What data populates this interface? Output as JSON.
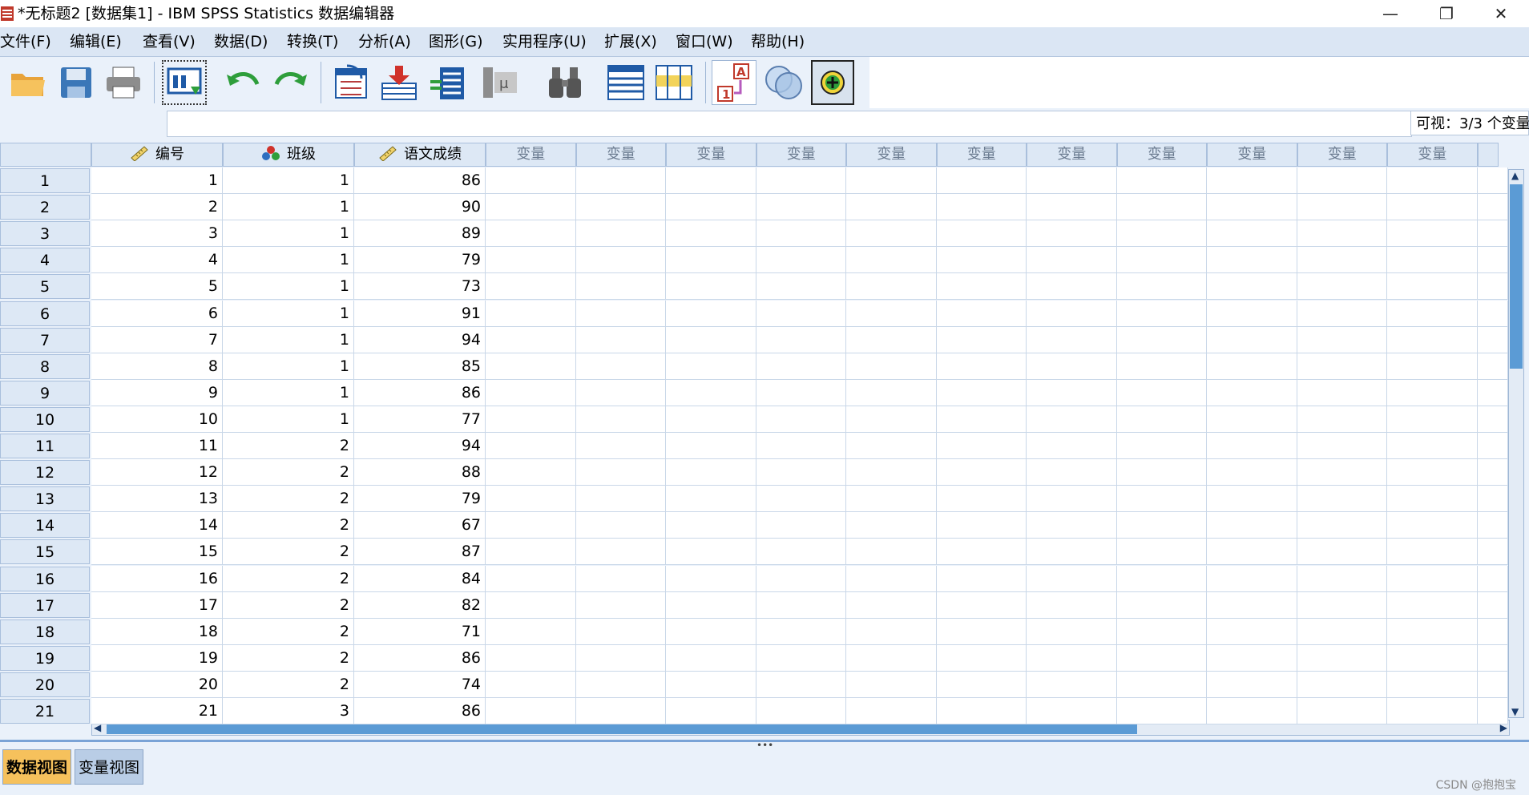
{
  "window": {
    "title": "*无标题2 [数据集1] - IBM SPSS Statistics 数据编辑器",
    "minimize": "—",
    "restore": "❐",
    "close": "✕"
  },
  "menu": [
    "文件(F)",
    "编辑(E)",
    "查看(V)",
    "数据(D)",
    "转换(T)",
    "分析(A)",
    "图形(G)",
    "实用程序(U)",
    "扩展(X)",
    "窗口(W)",
    "帮助(H)"
  ],
  "toolbar_icons": [
    "open-folder-icon",
    "save-icon",
    "print-icon",
    "recall-dialog-icon",
    "undo-icon",
    "redo-icon",
    "goto-case-icon",
    "goto-variable-icon",
    "variables-icon",
    "run-descriptives-icon",
    "find-icon",
    "insert-cases-icon",
    "insert-variable-icon",
    "split-file-icon",
    "select-cases-icon",
    "add-icon"
  ],
  "editbar": {
    "cell_ref": "",
    "cell_value": "",
    "visible_count": "可视：3/3 个变量"
  },
  "columns": [
    {
      "name": "编号",
      "icon": "ruler-icon"
    },
    {
      "name": "班级",
      "icon": "nominal-icon"
    },
    {
      "name": "语文成绩",
      "icon": "ruler-icon"
    }
  ],
  "empty_column_label": "变量",
  "empty_column_count": 11,
  "rows": [
    [
      1,
      1,
      86
    ],
    [
      2,
      1,
      90
    ],
    [
      3,
      1,
      89
    ],
    [
      4,
      1,
      79
    ],
    [
      5,
      1,
      73
    ],
    [
      6,
      1,
      91
    ],
    [
      7,
      1,
      94
    ],
    [
      8,
      1,
      85
    ],
    [
      9,
      1,
      86
    ],
    [
      10,
      1,
      77
    ],
    [
      11,
      2,
      94
    ],
    [
      12,
      2,
      88
    ],
    [
      13,
      2,
      79
    ],
    [
      14,
      2,
      67
    ],
    [
      15,
      2,
      87
    ],
    [
      16,
      2,
      84
    ],
    [
      17,
      2,
      82
    ],
    [
      18,
      2,
      71
    ],
    [
      19,
      2,
      86
    ],
    [
      20,
      2,
      74
    ],
    [
      21,
      3,
      86
    ]
  ],
  "tabs": [
    "数据视图",
    "变量视图"
  ],
  "active_tab": "数据视图",
  "watermark": "CSDN @抱抱宝",
  "colors": {
    "accent": "#5b9bd5",
    "active_tab": "#f6c15c",
    "header_bg": "#dde8f5"
  }
}
